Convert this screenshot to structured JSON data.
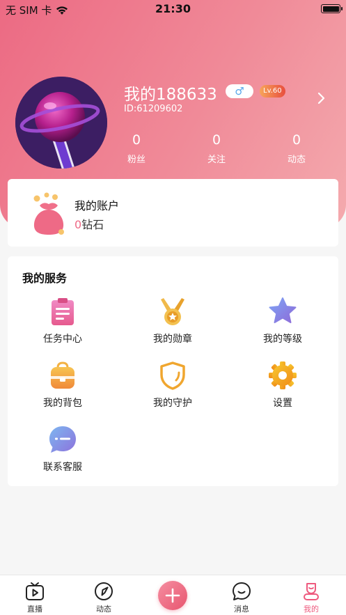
{
  "status_bar": {
    "carrier": "无 SIM 卡",
    "time": "21:30"
  },
  "profile": {
    "name": "我的188633",
    "gender_symbol": "♂",
    "level": "Lv.60",
    "id_text": "ID:61209602",
    "stats": [
      {
        "value": "0",
        "label": "粉丝"
      },
      {
        "value": "0",
        "label": "关注"
      },
      {
        "value": "0",
        "label": "动态"
      }
    ]
  },
  "account": {
    "title": "我的账户",
    "diamond_count": "0",
    "diamond_unit": "钻石"
  },
  "services": {
    "title": "我的服务",
    "items": [
      {
        "label": "任务中心",
        "icon": "task-clipboard-icon"
      },
      {
        "label": "我的勋章",
        "icon": "medal-icon"
      },
      {
        "label": "我的等级",
        "icon": "star-icon"
      },
      {
        "label": "我的背包",
        "icon": "backpack-icon"
      },
      {
        "label": "我的守护",
        "icon": "shield-icon"
      },
      {
        "label": "设置",
        "icon": "gear-icon"
      },
      {
        "label": "联系客服",
        "icon": "chat-bubble-icon"
      }
    ]
  },
  "tabbar": {
    "items": [
      {
        "label": "直播",
        "icon": "tv-icon"
      },
      {
        "label": "动态",
        "icon": "compass-icon"
      },
      {
        "label": "",
        "icon": "plus-icon"
      },
      {
        "label": "消息",
        "icon": "message-icon"
      },
      {
        "label": "我的",
        "icon": "profile-icon",
        "active": true
      }
    ]
  },
  "colors": {
    "accent": "#ee5a7e",
    "header_start": "#ec6a83",
    "header_end": "#f4aaae"
  }
}
